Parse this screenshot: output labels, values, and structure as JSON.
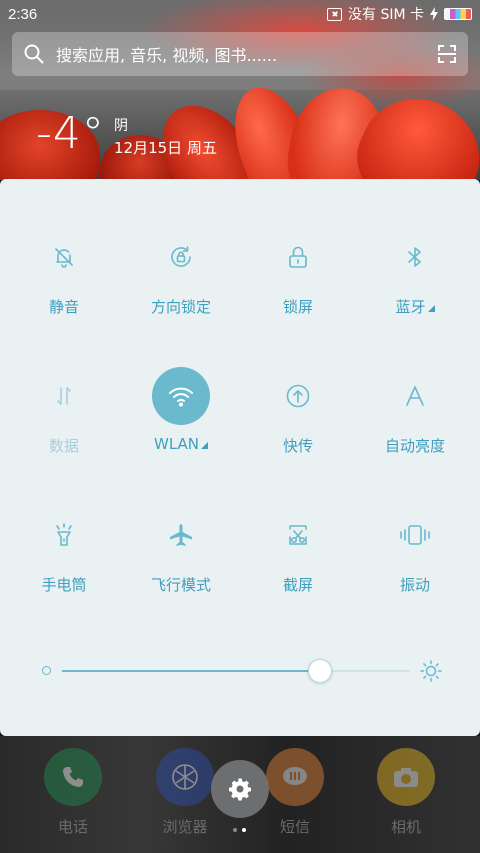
{
  "status_bar": {
    "time": "2:36",
    "sim_text": "没有 SIM 卡"
  },
  "search": {
    "placeholder": "搜索应用, 音乐, 视频, 图书......"
  },
  "weather": {
    "temperature": "-4°",
    "condition": "阴",
    "date": "12月15日 周五"
  },
  "tiles": [
    {
      "label": "静音",
      "icon": "bell-off-icon",
      "active": false
    },
    {
      "label": "方向锁定",
      "icon": "rotation-lock-icon",
      "active": false
    },
    {
      "label": "锁屏",
      "icon": "lock-icon",
      "active": false
    },
    {
      "label": "蓝牙",
      "icon": "bluetooth-icon",
      "active": false,
      "has_dropdown": true
    },
    {
      "label": "数据",
      "icon": "mobile-data-icon",
      "active": false,
      "disabled": true
    },
    {
      "label": "WLAN",
      "icon": "wifi-icon",
      "active": true,
      "has_dropdown": true
    },
    {
      "label": "快传",
      "icon": "quick-transfer-icon",
      "active": false
    },
    {
      "label": "自动亮度",
      "icon": "auto-brightness-icon",
      "active": false
    },
    {
      "label": "手电筒",
      "icon": "flashlight-icon",
      "active": false
    },
    {
      "label": "飞行模式",
      "icon": "airplane-icon",
      "active": false
    },
    {
      "label": "截屏",
      "icon": "screenshot-icon",
      "active": false
    },
    {
      "label": "振动",
      "icon": "vibrate-icon",
      "active": false
    }
  ],
  "brightness": {
    "level": 0.74
  },
  "dock": {
    "apps": [
      {
        "label": "电话",
        "icon": "phone-icon",
        "color": "#1e8e4e"
      },
      {
        "label": "浏览器",
        "icon": "browser-icon",
        "color": "#2d4fb0"
      },
      {
        "label": "短信",
        "icon": "message-icon",
        "color": "#e8873a"
      },
      {
        "label": "相机",
        "icon": "camera-icon",
        "color": "#e6b61c"
      }
    ],
    "page_dots": 2,
    "current_page": 1
  },
  "colors": {
    "accent": "#3f9fbf",
    "active_tile": "#6ab9cd",
    "panel_bg": "#e9f1f3"
  }
}
